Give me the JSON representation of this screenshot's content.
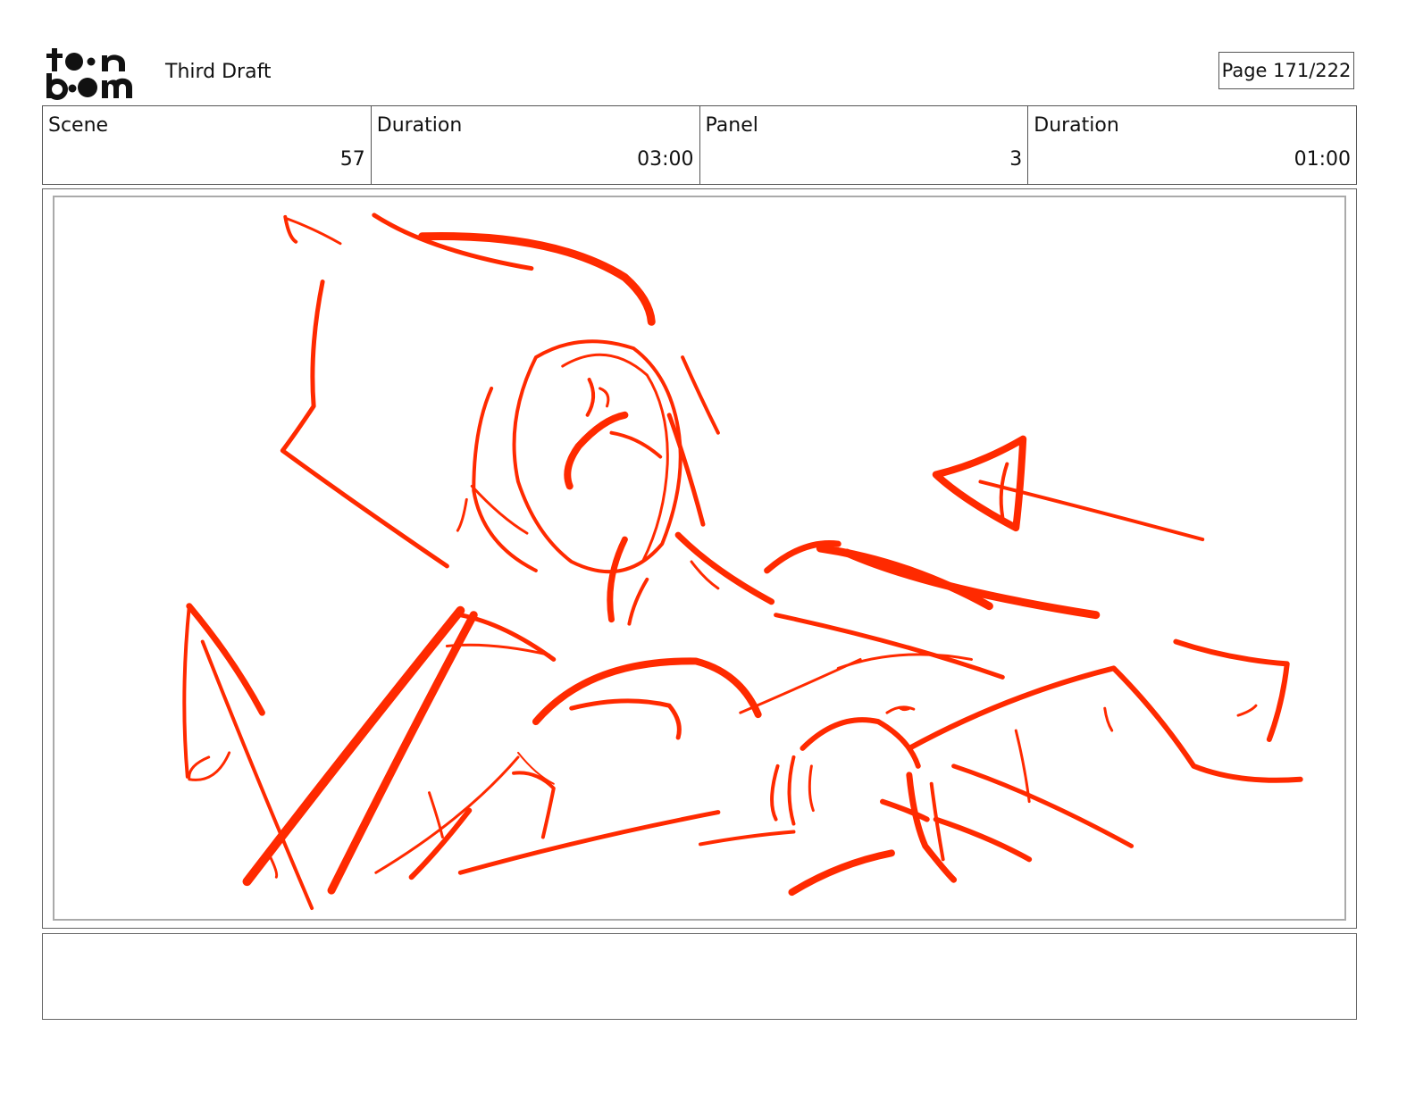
{
  "header": {
    "logo_text": "toon boom",
    "draft_title": "Third Draft",
    "page_label": "Page 171/222"
  },
  "info": {
    "scene_label": "Scene",
    "scene_value": "57",
    "scene_duration_label": "Duration",
    "scene_duration_value": "03:00",
    "panel_label": "Panel",
    "panel_value": "3",
    "panel_duration_label": "Duration",
    "panel_duration_value": "01:00"
  },
  "panel": {
    "sketch_color": "#ff2a00"
  },
  "notes": {
    "text": ""
  }
}
